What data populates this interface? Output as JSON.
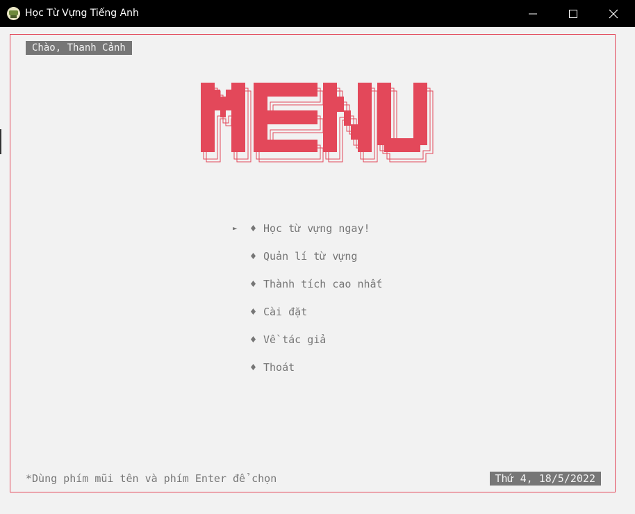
{
  "window": {
    "title": "Học Từ Vựng Tiếng Anh",
    "icon": "graduation-cap-icon",
    "controls": [
      "minimize-icon",
      "maximize-icon",
      "close-icon"
    ]
  },
  "greeting": "Chào, Thanh Cảnh",
  "banner": {
    "text": "MENU",
    "color": "#e3485a"
  },
  "menu": {
    "pointer": "►",
    "bullet": "♦",
    "selected_index": 0,
    "items": [
      {
        "label": "Học từ vựng ngay!"
      },
      {
        "label": "Quản lí từ vựng"
      },
      {
        "label": "Thành tích cao nhất"
      },
      {
        "label": "Cài đặt"
      },
      {
        "label": "Về tác giả"
      },
      {
        "label": "Thoát"
      }
    ]
  },
  "footer": {
    "hint": "*Dùng phím mũi tên và phím Enter để chọn",
    "date": "Thứ 4, 18/5/2022"
  },
  "colors": {
    "accent": "#e3485a",
    "text_muted": "#767676",
    "background": "#f2f2f2",
    "titlebar": "#000000"
  }
}
